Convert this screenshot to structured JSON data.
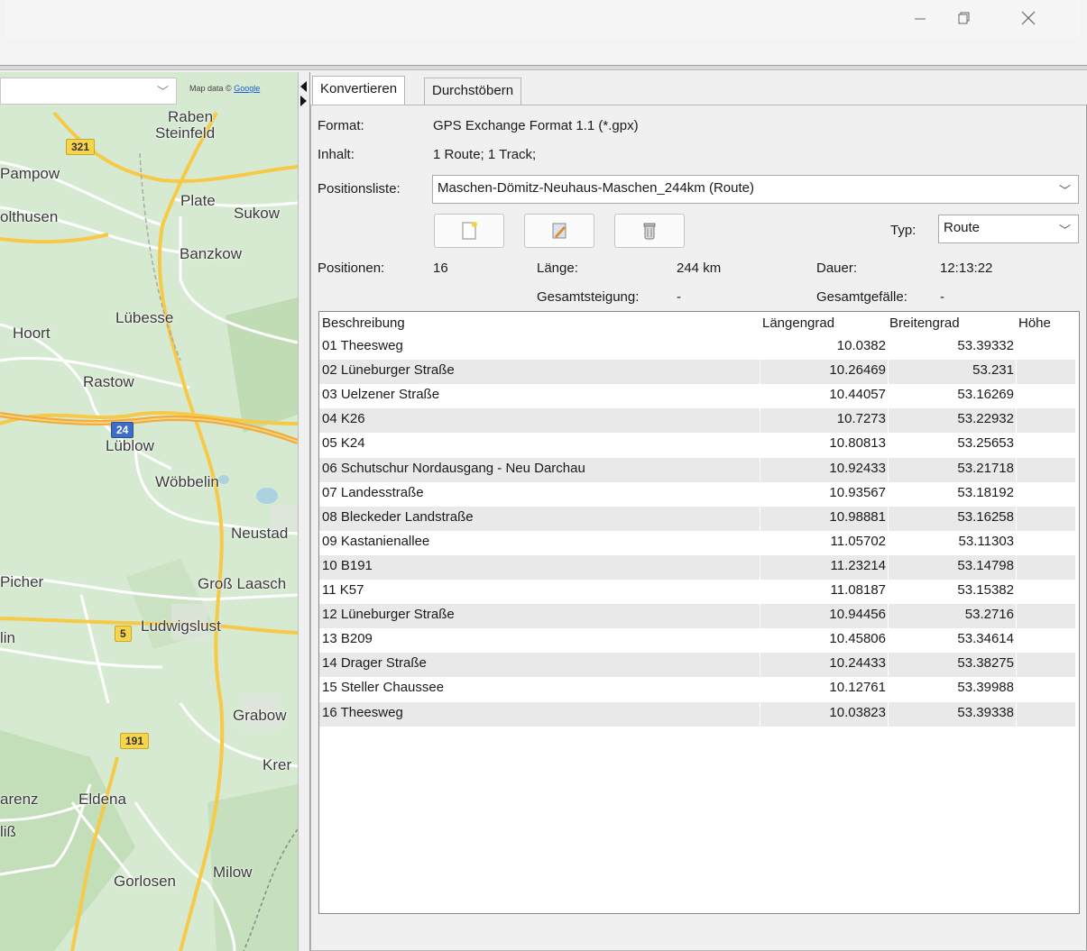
{
  "window": {
    "minimize_glyph": "—",
    "maximize_glyph": "▢",
    "close_glyph": "✕"
  },
  "map": {
    "attribution_prefix": "Map data ©",
    "attribution_link": "Google",
    "places": {
      "raben_steinfeld_1": "Raben",
      "raben_steinfeld_2": "Steinfeld",
      "pampow": "Pampow",
      "plate": "Plate",
      "sukow": "Sukow",
      "holthusen": "olthusen",
      "banzkow": "Banzkow",
      "luebesse": "Lübesse",
      "hoort": "Hoort",
      "rastow": "Rastow",
      "lueblow": "Lüblow",
      "woebbelin": "Wöbbelin",
      "neustadt": "Neustad",
      "picher": "Picher",
      "gross_laasch": "Groß Laasch",
      "ludwigslust": "Ludwigslust",
      "lin": "lin",
      "grabow": "Grabow",
      "krem": "Krer",
      "karenz": "arenz",
      "eldena": "Eldena",
      "liss": "liß",
      "milow": "Milow",
      "gorlosen": "Gorlosen"
    },
    "shields": {
      "b321": "321",
      "a24": "24",
      "b5": "5",
      "b191": "191"
    }
  },
  "tabs": [
    {
      "label": "Konvertieren",
      "active": true
    },
    {
      "label": "Durchstöbern",
      "active": false
    }
  ],
  "info": {
    "format_label": "Format:",
    "format_value": "GPS Exchange Format 1.1 (*.gpx)",
    "content_label": "Inhalt:",
    "content_value": "1 Route; 1 Track;",
    "poslist_label": "Positionsliste:",
    "poslist_value": "Maschen-Dömitz-Neuhaus-Maschen_244km (Route)",
    "type_label": "Typ:",
    "type_value": "Route",
    "positions_label": "Positionen:",
    "positions_value": "16",
    "length_label": "Länge:",
    "length_value": "244 km",
    "duration_label": "Dauer:",
    "duration_value": "12:13:22",
    "ascent_label": "Gesamtsteigung:",
    "ascent_value": "-",
    "descent_label": "Gesamtgefälle:",
    "descent_value": "-"
  },
  "toolbar": {
    "new_icon": "new-document-icon",
    "edit_icon": "edit-pencil-icon",
    "delete_icon": "trash-bin-icon"
  },
  "table": {
    "headers": [
      "Beschreibung",
      "Längengrad",
      "Breitengrad",
      "Höhe"
    ],
    "rows": [
      [
        "01 Theesweg",
        "10.0382",
        "53.39332",
        ""
      ],
      [
        "02 Lüneburger Straße",
        "10.26469",
        "53.231",
        ""
      ],
      [
        "03 Uelzener Straße",
        "10.44057",
        "53.16269",
        ""
      ],
      [
        "04 K26",
        "10.7273",
        "53.22932",
        ""
      ],
      [
        "05 K24",
        "10.80813",
        "53.25653",
        ""
      ],
      [
        "06 Schutschur Nordausgang - Neu Darchau",
        "10.92433",
        "53.21718",
        ""
      ],
      [
        "07 Landesstraße",
        "10.93567",
        "53.18192",
        ""
      ],
      [
        "08 Bleckeder Landstraße",
        "10.98881",
        "53.16258",
        ""
      ],
      [
        "09 Kastanienallee",
        "11.05702",
        "53.11303",
        ""
      ],
      [
        "10 B191",
        "11.23214",
        "53.14798",
        ""
      ],
      [
        "11 K57",
        "11.08187",
        "53.15382",
        ""
      ],
      [
        "12 Lüneburger Straße",
        "10.94456",
        "53.2716",
        ""
      ],
      [
        "13 B209",
        "10.45806",
        "53.34614",
        ""
      ],
      [
        "14 Drager Straße",
        "10.24433",
        "53.38275",
        ""
      ],
      [
        "15 Steller Chaussee",
        "10.12761",
        "53.39988",
        ""
      ],
      [
        "16 Theesweg",
        "10.03823",
        "53.39338",
        ""
      ]
    ]
  },
  "colors": {
    "map_land": "#d6ead1",
    "highway": "#f7c948",
    "alt_row": "#e9e9e9"
  }
}
